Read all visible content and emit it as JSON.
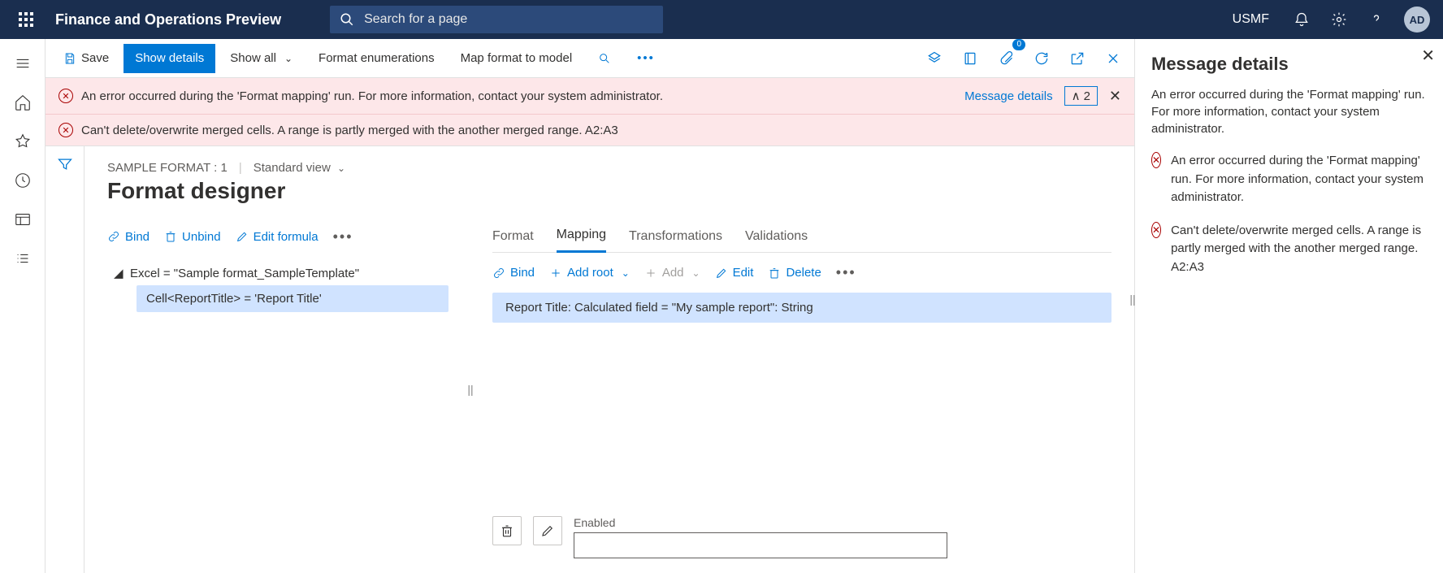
{
  "header": {
    "app_title": "Finance and Operations Preview",
    "search_placeholder": "Search for a page",
    "company": "USMF",
    "avatar": "AD"
  },
  "commandbar": {
    "save": "Save",
    "show_details": "Show details",
    "show_all": "Show all",
    "format_enum": "Format enumerations",
    "map_format": "Map format to model",
    "attach_count": "0"
  },
  "banners": {
    "msg1": "An error occurred during the 'Format mapping' run. For more information, contact your system administrator.",
    "msg2": "Can't delete/overwrite merged cells. A range is partly merged with the another merged range. A2:A3",
    "details_link": "Message details",
    "collapse_count": "2"
  },
  "designer": {
    "breadcrumb": "SAMPLE FORMAT : 1",
    "view": "Standard view",
    "title": "Format designer",
    "left_toolbar": {
      "bind": "Bind",
      "unbind": "Unbind",
      "edit_formula": "Edit formula"
    },
    "tree": {
      "root": "Excel = \"Sample format_SampleTemplate\"",
      "child": "Cell<ReportTitle> = 'Report Title'"
    },
    "tabs": {
      "format": "Format",
      "mapping": "Mapping",
      "transformations": "Transformations",
      "validations": "Validations"
    },
    "right_toolbar": {
      "bind": "Bind",
      "add_root": "Add root",
      "add": "Add",
      "edit": "Edit",
      "delete": "Delete"
    },
    "mapping_row": "Report Title: Calculated field = \"My sample report\": String",
    "enabled_label": "Enabled"
  },
  "panel": {
    "title": "Message details",
    "desc": "An error occurred during the 'Format mapping' run. For more information, contact your system administrator.",
    "items": [
      "An error occurred during the 'Format mapping' run. For more information, contact your system administrator.",
      "Can't delete/overwrite merged cells. A range is partly merged with the another merged range. A2:A3"
    ]
  }
}
